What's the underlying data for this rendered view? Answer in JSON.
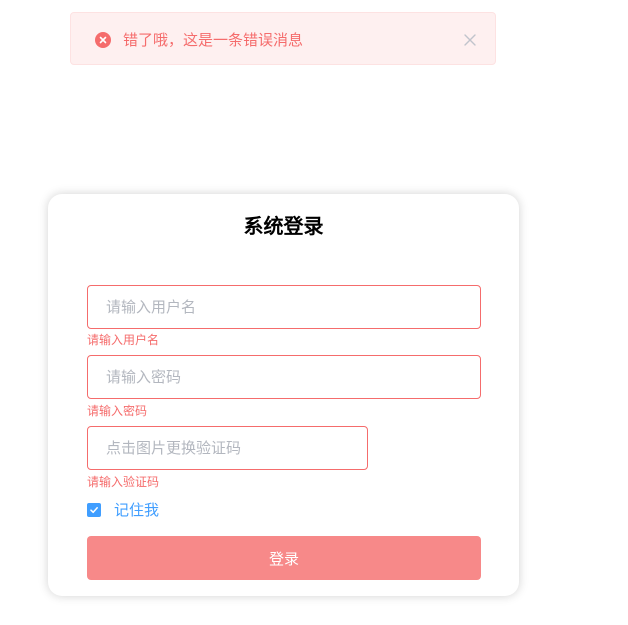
{
  "alert": {
    "message": "错了哦，这是一条错误消息",
    "type": "error",
    "icon": "error-circle-icon",
    "close_icon": "close-icon"
  },
  "login": {
    "title": "系统登录",
    "username": {
      "value": "",
      "placeholder": "请输入用户名",
      "error": "请输入用户名"
    },
    "password": {
      "value": "",
      "placeholder": "请输入密码",
      "error": "请输入密码"
    },
    "captcha": {
      "value": "",
      "placeholder": "点击图片更换验证码",
      "error": "请输入验证码"
    },
    "remember": {
      "label": "记住我",
      "checked": true
    },
    "submit_label": "登录"
  },
  "colors": {
    "error": "#f56c6c",
    "primary": "#409eff",
    "button_bg": "#f78989",
    "alert_bg": "#fef0f0"
  }
}
